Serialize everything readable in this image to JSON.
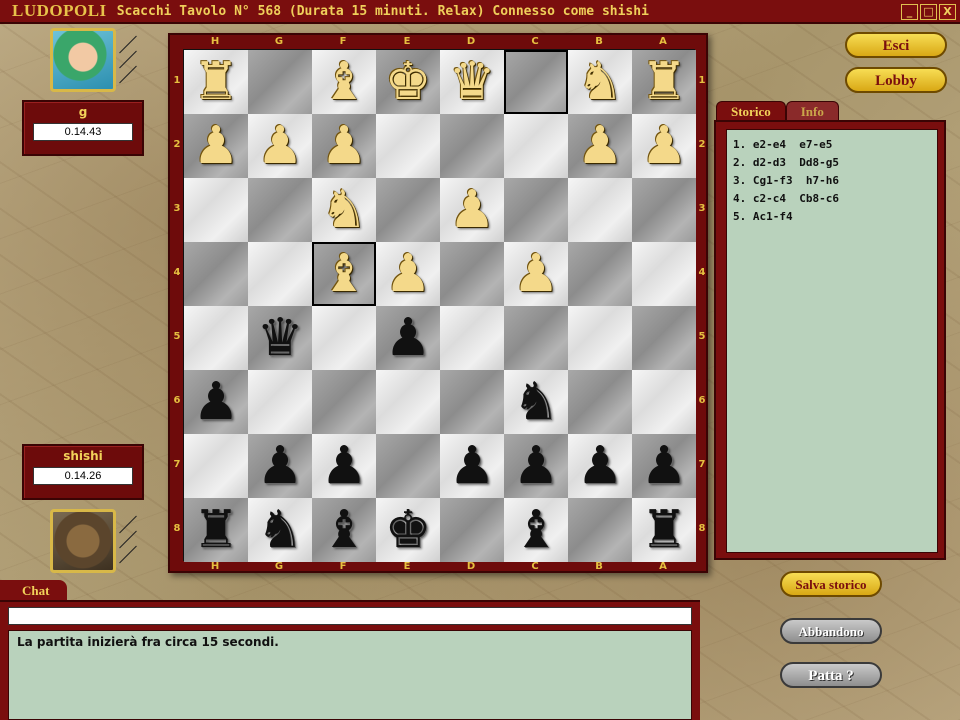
{
  "titlebar": {
    "logo": "LUDOPOLI",
    "title": "Scacchi Tavolo N° 568 (Durata 15 minuti. Relax) Connesso come shishi",
    "minimize_label": "_",
    "maximize_label": "□",
    "close_label": "X"
  },
  "player_top": {
    "name": "g",
    "time": "0.14.43",
    "avatar_icon": "anime-girl-avatar-icon"
  },
  "player_bottom": {
    "name": "shishi",
    "time": "0.14.26",
    "avatar_icon": "lion-avatar-icon"
  },
  "board": {
    "files": [
      "H",
      "G",
      "F",
      "E",
      "D",
      "C",
      "B",
      "A"
    ],
    "ranks": [
      "1",
      "2",
      "3",
      "4",
      "5",
      "6",
      "7",
      "8"
    ],
    "rows": [
      [
        "wR",
        "",
        "wB",
        "wK",
        "wQ",
        "",
        "wN",
        "wR"
      ],
      [
        "wP",
        "wP",
        "wP",
        "",
        "",
        "",
        "wP",
        "wP"
      ],
      [
        "",
        "",
        "wN",
        "",
        "wP",
        "",
        "",
        ""
      ],
      [
        "",
        "",
        "wB",
        "wP",
        "",
        "wP",
        "",
        ""
      ],
      [
        "",
        "bQ",
        "",
        "bP",
        "",
        "",
        "",
        ""
      ],
      [
        "bP",
        "",
        "",
        "",
        "",
        "bN",
        "",
        ""
      ],
      [
        "",
        "bP",
        "bP",
        "",
        "bP",
        "bP",
        "bP",
        "bP"
      ],
      [
        "bR",
        "bN",
        "bB",
        "bK",
        "",
        "bB",
        "",
        "bR"
      ]
    ],
    "highlights": [
      "1-C",
      "4-F"
    ]
  },
  "buttons": {
    "esci": "Esci",
    "lobby": "Lobby",
    "salva_storico": "Salva storico",
    "abbandono": "Abbandono",
    "patta": "Patta ?"
  },
  "tabs": {
    "storico": "Storico",
    "info": "Info"
  },
  "moves": [
    "1. e2-e4  e7-e5",
    "2. d2-d3  Dd8-g5",
    "3. Cg1-f3  h7-h6",
    "4. c2-c4  Cb8-c6",
    "5. Ac1-f4"
  ],
  "chat": {
    "tab_label": "Chat",
    "input_value": "",
    "messages": [
      "La partita inizierà fra circa 15 secondi."
    ]
  },
  "colors": {
    "accent": "#7a0e0e",
    "gold": "#f2d25a",
    "panel_green": "#b9d2bc"
  }
}
